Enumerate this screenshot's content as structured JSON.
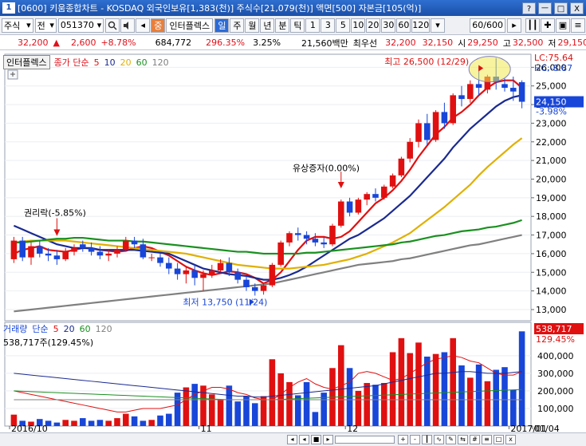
{
  "window": {
    "number": "1",
    "title": "[0600] 키움종합차트 - KOSDAQ 외국인보유[1,383(천)] 주식수[21,079(천)] 액면[500] 자본금[105(억)]",
    "buttons": [
      "?",
      "ㅡ",
      "□",
      "X"
    ]
  },
  "toolbar": {
    "market": "주식",
    "mode": "전",
    "code": "051370",
    "stock_name": "인터플렉스",
    "periods": [
      "일",
      "주",
      "월",
      "년",
      "분",
      "틱"
    ],
    "active_period": "일",
    "intervals": [
      "1",
      "3",
      "5",
      "10",
      "20",
      "30",
      "60",
      "120"
    ],
    "count": "60/600"
  },
  "quote": {
    "price": "32,200",
    "arrow": "▲",
    "change": "2,600",
    "change_pct": "+8.78%",
    "volume": "684,772",
    "vol_ratio": "296.35%",
    "turnover": "3.25%",
    "amount": "21,560백만",
    "label_last": "최우선",
    "ask": "32,200",
    "bid": "32,150",
    "open_label": "시",
    "open": "29,250",
    "high_label": "고",
    "high": "32,500",
    "low_label": "저",
    "low": "29,150"
  },
  "legend_price": {
    "stock": "인터플렉스",
    "title": "종가 단순",
    "ma": [
      {
        "label": "5",
        "color": "#e01010"
      },
      {
        "label": "10",
        "color": "#1a2a90"
      },
      {
        "label": "20",
        "color": "#e0b000"
      },
      {
        "label": "60",
        "color": "#1a9020"
      },
      {
        "label": "120",
        "color": "#808080"
      }
    ]
  },
  "legend_volume": {
    "title": "거래량",
    "subtitle": "단순",
    "ma": [
      {
        "label": "5",
        "color": "#e01010"
      },
      {
        "label": "20",
        "color": "#1a2a90"
      },
      {
        "label": "60",
        "color": "#1a9020"
      },
      {
        "label": "120",
        "color": "#808080"
      }
    ],
    "current": "538,717주(129.45%)"
  },
  "annotations": {
    "high": "최고 26,500 (12/29)",
    "low": "최저 13,750 (11/24)",
    "rights": "권리락(-5.85%)",
    "capital": "유상증자(0.00%)"
  },
  "right_axis": {
    "lc": "LC:75.64",
    "hc": "HC:-8.87",
    "last_price": "24,150",
    "last_pct": "-3.98%",
    "vol_last": "538,717",
    "vol_pct": "129.45%"
  },
  "chart_data": {
    "type": "candlestick",
    "price_axis": [
      "26,000",
      "25,000",
      "24,000",
      "23,000",
      "22,000",
      "21,000",
      "20,000",
      "19,000",
      "18,000",
      "17,000",
      "16,000",
      "15,000",
      "14,000",
      "13,000"
    ],
    "volume_axis": [
      "400,000",
      "300,000",
      "200,000",
      "100,000"
    ],
    "x_labels": [
      "2016/10",
      "11",
      "12",
      "2017/01",
      "01/04"
    ],
    "ylim": [
      12400,
      26700
    ],
    "vol_max": 590000,
    "candles": [
      [
        15700,
        16900,
        15500,
        16700
      ],
      [
        16700,
        16900,
        15600,
        15800
      ],
      [
        15800,
        16600,
        15400,
        16400
      ],
      [
        16400,
        16700,
        15800,
        16000
      ],
      [
        16000,
        16300,
        15600,
        15900
      ],
      [
        15900,
        16200,
        15400,
        15700
      ],
      [
        15700,
        16300,
        15600,
        16100
      ],
      [
        16100,
        16500,
        15900,
        16300
      ],
      [
        16500,
        16700,
        16100,
        16300
      ],
      [
        16300,
        16600,
        15900,
        16100
      ],
      [
        16100,
        16400,
        15700,
        15900
      ],
      [
        15900,
        16200,
        15600,
        16000
      ],
      [
        16000,
        16400,
        15800,
        16200
      ],
      [
        16200,
        16900,
        16100,
        16700
      ],
      [
        16700,
        16900,
        16300,
        16500
      ],
      [
        16500,
        16800,
        15700,
        15800
      ],
      [
        15800,
        16000,
        15600,
        15800
      ],
      [
        15800,
        16000,
        15300,
        15500
      ],
      [
        15500,
        15800,
        14900,
        15200
      ],
      [
        15200,
        15500,
        14600,
        14900
      ],
      [
        14900,
        15300,
        14400,
        15100
      ],
      [
        15100,
        15400,
        14300,
        14700
      ],
      [
        14700,
        15100,
        14000,
        14900
      ],
      [
        14900,
        15400,
        14700,
        15100
      ],
      [
        15100,
        15700,
        15000,
        15500
      ],
      [
        15500,
        15800,
        14800,
        15000
      ],
      [
        15000,
        15200,
        14400,
        14600
      ],
      [
        14600,
        14800,
        14000,
        14200
      ],
      [
        14200,
        14400,
        13750,
        14000
      ],
      [
        14000,
        14400,
        13800,
        14300
      ],
      [
        14300,
        15500,
        14200,
        15400
      ],
      [
        15400,
        16700,
        15300,
        16600
      ],
      [
        16600,
        17200,
        16400,
        17100
      ],
      [
        17100,
        17400,
        16700,
        17000
      ],
      [
        17000,
        17200,
        16500,
        16800
      ],
      [
        16800,
        17100,
        16400,
        16600
      ],
      [
        16600,
        16900,
        16300,
        16500
      ],
      [
        16500,
        17600,
        16400,
        17500
      ],
      [
        17500,
        18900,
        17400,
        18800
      ],
      [
        18800,
        19000,
        18000,
        18200
      ],
      [
        18200,
        19000,
        18100,
        18900
      ],
      [
        18900,
        19300,
        18600,
        19200
      ],
      [
        19200,
        19500,
        18800,
        19000
      ],
      [
        19000,
        19700,
        18900,
        19600
      ],
      [
        19600,
        20300,
        19500,
        20200
      ],
      [
        20200,
        21200,
        20100,
        21100
      ],
      [
        21100,
        22200,
        20900,
        22000
      ],
      [
        22000,
        23200,
        21700,
        23000
      ],
      [
        23000,
        23500,
        21800,
        22100
      ],
      [
        22100,
        23700,
        22000,
        23600
      ],
      [
        23600,
        24100,
        22700,
        23000
      ],
      [
        23000,
        24600,
        22900,
        24500
      ],
      [
        24500,
        25000,
        23900,
        24300
      ],
      [
        24300,
        25300,
        24100,
        25100
      ],
      [
        25100,
        26000,
        24500,
        24900
      ],
      [
        24800,
        25600,
        24600,
        25500
      ],
      [
        25500,
        26500,
        24800,
        25200
      ],
      [
        25100,
        25400,
        24700,
        24900
      ],
      [
        24900,
        25500,
        24200,
        24700
      ],
      [
        25200,
        25300,
        23800,
        24150
      ]
    ],
    "volumes": [
      65000,
      30000,
      25000,
      40000,
      30000,
      20000,
      35000,
      30000,
      45000,
      30000,
      35000,
      30000,
      45000,
      70000,
      55000,
      30000,
      35000,
      60000,
      70000,
      190000,
      220000,
      240000,
      230000,
      180000,
      150000,
      230000,
      140000,
      170000,
      130000,
      170000,
      380000,
      300000,
      250000,
      175000,
      250000,
      80000,
      190000,
      330000,
      460000,
      330000,
      200000,
      245000,
      235000,
      245000,
      420000,
      500000,
      415000,
      475000,
      395000,
      410000,
      420000,
      500000,
      345000,
      275000,
      350000,
      255000,
      320000,
      335000,
      205000,
      538717
    ],
    "ma": {
      "5": [
        16000,
        16200,
        16300,
        16400,
        16200,
        16150,
        16100,
        16200,
        16300,
        16280,
        16200,
        16150,
        16100,
        16150,
        16300,
        16400,
        16300,
        16100,
        15900,
        15600,
        15300,
        15100,
        14950,
        14850,
        14950,
        15050,
        15000,
        14900,
        14700,
        14400,
        14600,
        15000,
        15600,
        16200,
        16700,
        16900,
        16900,
        16800,
        16900,
        17200,
        17700,
        18200,
        18700,
        19000,
        19400,
        19900,
        20500,
        21200,
        21800,
        22400,
        22800,
        23300,
        23600,
        24000,
        24500,
        24900,
        25200,
        25300,
        25300,
        24900
      ],
      "10": [
        17500,
        17300,
        17100,
        16900,
        16700,
        16500,
        16400,
        16300,
        16300,
        16300,
        16200,
        16200,
        16200,
        16200,
        16200,
        16150,
        16100,
        16050,
        16000,
        15800,
        15600,
        15400,
        15200,
        15100,
        15000,
        14900,
        14850,
        14800,
        14700,
        14600,
        14600,
        14700,
        14850,
        15050,
        15300,
        15600,
        15900,
        16200,
        16500,
        16800,
        17000,
        17300,
        17600,
        17900,
        18300,
        18700,
        19100,
        19600,
        20100,
        20600,
        21100,
        21700,
        22200,
        22700,
        23100,
        23500,
        23900,
        24200,
        24400,
        24500
      ],
      "20": [
        16600,
        16650,
        16700,
        16700,
        16700,
        16700,
        16700,
        16650,
        16600,
        16550,
        16500,
        16450,
        16400,
        16350,
        16300,
        16250,
        16200,
        16150,
        16100,
        16050,
        16000,
        15900,
        15800,
        15700,
        15600,
        15500,
        15400,
        15350,
        15300,
        15250,
        15200,
        15200,
        15200,
        15250,
        15300,
        15350,
        15400,
        15500,
        15600,
        15700,
        15850,
        16000,
        16200,
        16400,
        16600,
        16850,
        17100,
        17450,
        17800,
        18150,
        18500,
        18900,
        19300,
        19700,
        20200,
        20650,
        21050,
        21450,
        21850,
        22200
      ],
      "60": [
        16600,
        16600,
        16650,
        16700,
        16750,
        16800,
        16800,
        16850,
        16850,
        16800,
        16750,
        16700,
        16700,
        16700,
        16650,
        16650,
        16600,
        16550,
        16500,
        16450,
        16400,
        16350,
        16300,
        16250,
        16200,
        16150,
        16100,
        16100,
        16050,
        16000,
        16000,
        16000,
        16000,
        16000,
        16050,
        16050,
        16100,
        16150,
        16200,
        16250,
        16300,
        16350,
        16400,
        16450,
        16500,
        16600,
        16650,
        16750,
        16850,
        16950,
        17000,
        17100,
        17200,
        17250,
        17300,
        17400,
        17450,
        17550,
        17650,
        17800
      ],
      "120": [
        12900,
        12950,
        13000,
        13050,
        13100,
        13150,
        13200,
        13250,
        13300,
        13350,
        13400,
        13450,
        13500,
        13550,
        13600,
        13650,
        13700,
        13750,
        13800,
        13850,
        13900,
        13950,
        14000,
        14050,
        14100,
        14150,
        14200,
        14250,
        14300,
        14350,
        14400,
        14500,
        14600,
        14700,
        14800,
        14900,
        15000,
        15100,
        15200,
        15300,
        15400,
        15450,
        15500,
        15550,
        15600,
        15700,
        15750,
        15850,
        15950,
        16050,
        16150,
        16250,
        16350,
        16450,
        16500,
        16600,
        16700,
        16800,
        16900,
        17000
      ]
    },
    "vol_ma": {
      "5": [
        200000,
        190000,
        180000,
        170000,
        160000,
        150000,
        140000,
        130000,
        120000,
        110000,
        100000,
        90000,
        80000,
        80000,
        90000,
        100000,
        100000,
        100000,
        110000,
        120000,
        150000,
        180000,
        200000,
        220000,
        220000,
        210000,
        190000,
        180000,
        160000,
        150000,
        150000,
        180000,
        220000,
        250000,
        270000,
        240000,
        220000,
        210000,
        230000,
        250000,
        300000,
        310000,
        300000,
        280000,
        260000,
        270000,
        300000,
        330000,
        360000,
        380000,
        390000,
        400000,
        390000,
        370000,
        360000,
        330000,
        300000,
        290000,
        290000,
        310000
      ],
      "20": [
        300000,
        295000,
        290000,
        285000,
        280000,
        275000,
        270000,
        265000,
        260000,
        255000,
        250000,
        245000,
        240000,
        235000,
        230000,
        225000,
        220000,
        215000,
        210000,
        205000,
        200000,
        195000,
        190000,
        185000,
        180000,
        175000,
        170000,
        170000,
        165000,
        165000,
        170000,
        175000,
        180000,
        185000,
        190000,
        195000,
        200000,
        205000,
        210000,
        215000,
        220000,
        225000,
        230000,
        240000,
        250000,
        260000,
        270000,
        280000,
        290000,
        300000,
        300000,
        305000,
        310000,
        310000,
        305000,
        300000,
        300000,
        300000,
        305000,
        310000
      ],
      "60": [
        200000,
        198000,
        196000,
        194000,
        192000,
        190000,
        188000,
        186000,
        184000,
        182000,
        180000,
        178000,
        176000,
        174000,
        172000,
        170000,
        168000,
        166000,
        164000,
        162000,
        160000,
        158000,
        156000,
        154000,
        152000,
        150000,
        150000,
        150000,
        150000,
        150000,
        150000,
        152000,
        154000,
        156000,
        158000,
        160000,
        162000,
        164000,
        166000,
        168000,
        170000,
        172000,
        174000,
        176000,
        178000,
        180000,
        182000,
        184000,
        186000,
        188000,
        190000,
        192000,
        194000,
        196000,
        198000,
        200000,
        202000,
        204000,
        206000,
        208000
      ],
      "120": [
        150000,
        150000,
        150000,
        150000,
        150000,
        150000,
        150000,
        150000,
        150000,
        150000,
        150000,
        150000,
        150000,
        150000,
        150000,
        150000,
        150000,
        150000,
        150000,
        150000,
        150000,
        150000,
        150000,
        150000,
        150000,
        150000,
        150000,
        150000,
        150000,
        150000,
        150000,
        150000,
        150000,
        150000,
        150000,
        150000,
        150000,
        150000,
        150000,
        150000,
        150000,
        150000,
        150000,
        150000,
        150000,
        150000,
        150000,
        150000,
        150000,
        150000,
        150000,
        150000,
        150000,
        150000,
        150000,
        150000,
        150000,
        150000,
        150000,
        150000
      ]
    }
  }
}
